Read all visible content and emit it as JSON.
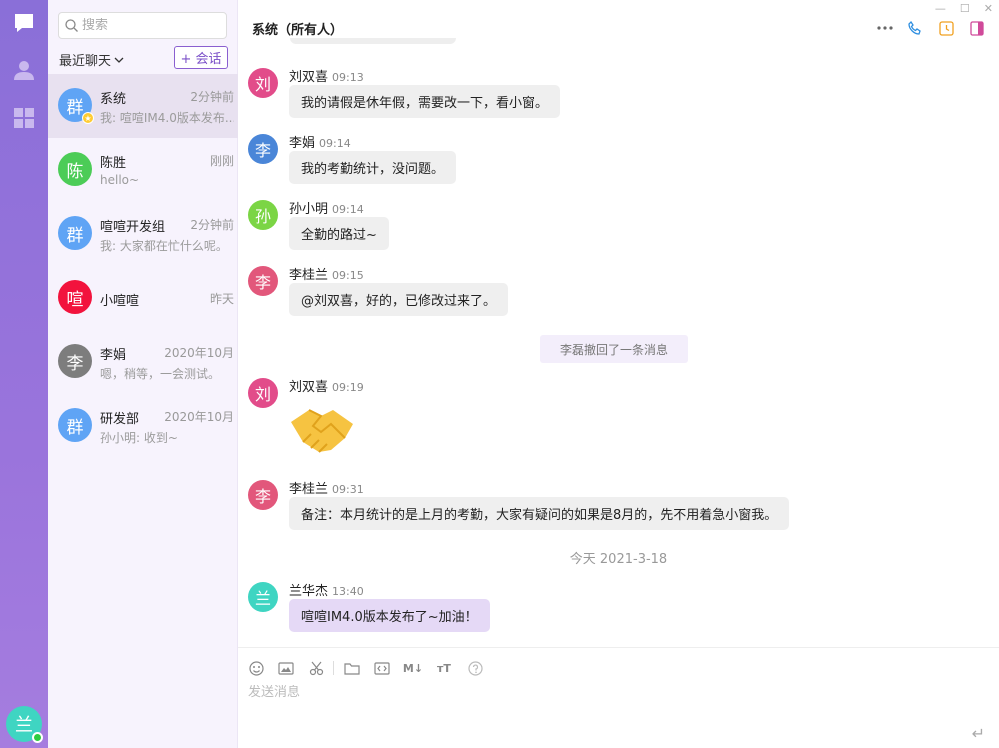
{
  "rail": {
    "user_avatar": "兰"
  },
  "search": {
    "placeholder": "搜索"
  },
  "list": {
    "recent_label": "最近聊天",
    "new_chat_label": "+ 会话",
    "conversations": [
      {
        "avatar": "群",
        "color": "#5fa4f5",
        "name": "系统",
        "time": "2分钟前",
        "preview": "我: 喧喧IM4.0版本发布...",
        "active": true
      },
      {
        "avatar": "陈",
        "color": "#4ccc57",
        "name": "陈胜",
        "time": "刚刚",
        "preview": "hello~"
      },
      {
        "avatar": "群",
        "color": "#5fa4f5",
        "name": "喧喧开发组",
        "time": "2分钟前",
        "preview": "我: 大家都在忙什么呢。"
      },
      {
        "avatar": "喧",
        "color": "#f2133d",
        "name": "小喧喧",
        "time": "昨天",
        "preview": ""
      },
      {
        "avatar": "李",
        "color": "#7d7d7d",
        "name": "李娟",
        "time": "2020年10月",
        "preview": "嗯，稍等，一会测试。"
      },
      {
        "avatar": "群",
        "color": "#5fa4f5",
        "name": "研发部",
        "time": "2020年10月",
        "preview": "孙小明: 收到~"
      }
    ]
  },
  "chat": {
    "title": "系统（所有人）",
    "messages": [
      {
        "avatar": "刘",
        "color": "#e24c8a",
        "sender": "刘双喜",
        "time": "09:13",
        "text": "我的请假是休年假，需要改一下，看小窗。"
      },
      {
        "avatar": "李",
        "color": "#4a86d8",
        "sender": "李娟",
        "time": "09:14",
        "text": "我的考勤统计，没问题。"
      },
      {
        "avatar": "孙",
        "color": "#7bd545",
        "sender": "孙小明",
        "time": "09:14",
        "text": "全勤的路过~"
      },
      {
        "avatar": "李",
        "color": "#e2577b",
        "sender": "李桂兰",
        "time": "09:15",
        "text": "@刘双喜，好的，已修改过来了。"
      },
      {
        "avatar": "刘",
        "color": "#e24c8a",
        "sender": "刘双喜",
        "time": "09:19",
        "text": ""
      },
      {
        "avatar": "李",
        "color": "#e2577b",
        "sender": "李桂兰",
        "time": "09:31",
        "text": "备注：本月统计的是上月的考勤，大家有疑问的如果是8月的，先不用着急小窗我。"
      },
      {
        "avatar": "兰",
        "color": "#3fd5c2",
        "sender": "兰华杰",
        "time": "13:40",
        "text": "喧喧IM4.0版本发布了~加油！"
      }
    ],
    "recall_note": "李磊撤回了一条消息",
    "date_separator": "今天 2021-3-18"
  },
  "composer": {
    "placeholder": "发送消息"
  }
}
